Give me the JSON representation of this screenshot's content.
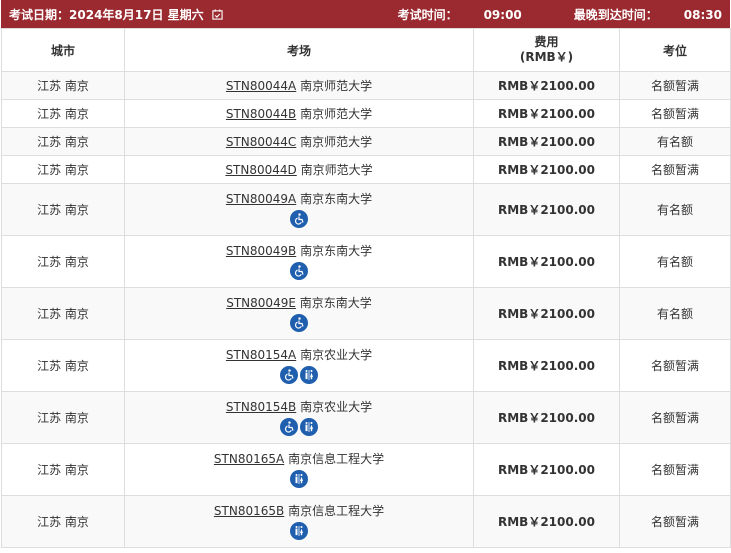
{
  "header": {
    "exam_date_label": "考试日期：",
    "exam_date": "2024年8月17日 星期六",
    "exam_time_label": "考试时间：",
    "exam_time": "09:00",
    "arrive_label": "最晚到达时间：",
    "arrive_time": "08:30"
  },
  "columns": {
    "city": "城市",
    "venue": "考场",
    "fee_l1": "费用",
    "fee_l2": "(RMB￥)",
    "seats": "考位"
  },
  "rows": [
    {
      "city": "江苏 南京",
      "code": "STN80044A",
      "venue": "南京师范大学",
      "fee": "RMB￥2100.00",
      "seats": "名额暂满",
      "icons": []
    },
    {
      "city": "江苏 南京",
      "code": "STN80044B",
      "venue": "南京师范大学",
      "fee": "RMB￥2100.00",
      "seats": "名额暂满",
      "icons": []
    },
    {
      "city": "江苏 南京",
      "code": "STN80044C",
      "venue": "南京师范大学",
      "fee": "RMB￥2100.00",
      "seats": "有名额",
      "icons": []
    },
    {
      "city": "江苏 南京",
      "code": "STN80044D",
      "venue": "南京师范大学",
      "fee": "RMB￥2100.00",
      "seats": "名额暂满",
      "icons": []
    },
    {
      "city": "江苏 南京",
      "code": "STN80049A",
      "venue": "南京东南大学",
      "fee": "RMB￥2100.00",
      "seats": "有名额",
      "icons": [
        "wheelchair-icon"
      ]
    },
    {
      "city": "江苏 南京",
      "code": "STN80049B",
      "venue": "南京东南大学",
      "fee": "RMB￥2100.00",
      "seats": "有名额",
      "icons": [
        "wheelchair-icon"
      ]
    },
    {
      "city": "江苏 南京",
      "code": "STN80049E",
      "venue": "南京东南大学",
      "fee": "RMB￥2100.00",
      "seats": "有名额",
      "icons": [
        "wheelchair-icon"
      ]
    },
    {
      "city": "江苏 南京",
      "code": "STN80154A",
      "venue": "南京农业大学",
      "fee": "RMB￥2100.00",
      "seats": "名额暂满",
      "icons": [
        "wheelchair-icon",
        "restroom-icon"
      ]
    },
    {
      "city": "江苏 南京",
      "code": "STN80154B",
      "venue": "南京农业大学",
      "fee": "RMB￥2100.00",
      "seats": "名额暂满",
      "icons": [
        "wheelchair-icon",
        "restroom-icon"
      ]
    },
    {
      "city": "江苏 南京",
      "code": "STN80165A",
      "venue": "南京信息工程大学",
      "fee": "RMB￥2100.00",
      "seats": "名额暂满",
      "icons": [
        "restroom-icon"
      ]
    },
    {
      "city": "江苏 南京",
      "code": "STN80165B",
      "venue": "南京信息工程大学",
      "fee": "RMB￥2100.00",
      "seats": "名额暂满",
      "icons": [
        "restroom-icon"
      ]
    }
  ],
  "colors": {
    "header_bar": "#9b2a30",
    "icon_badge": "#1f5fae"
  }
}
